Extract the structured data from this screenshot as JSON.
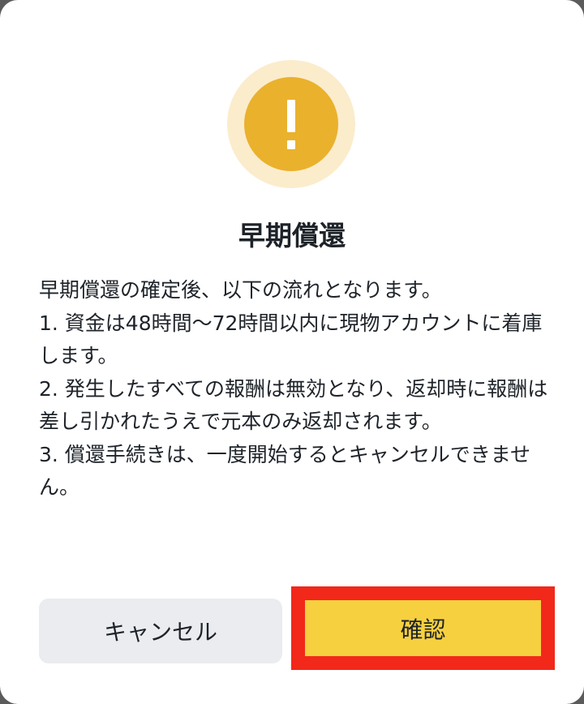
{
  "dialog": {
    "icon": "warning-icon",
    "title": "早期償還",
    "intro": "早期償還の確定後、以下の流れとなります。",
    "items": [
      "1. 資金は48時間〜72時間以内に現物アカウントに着庫します。",
      "2. 発生したすべての報酬は無効となり、返却時に報酬は差し引かれたうえで元本のみ返却されます。",
      "3. 償還手続きは、一度開始するとキャンセルできません。"
    ],
    "cancel_label": "キャンセル",
    "confirm_label": "確認"
  },
  "colors": {
    "warning_ring": "#fbeccc",
    "warning_fill": "#eab12d",
    "confirm_button": "#f6d03f",
    "cancel_button": "#eaecef",
    "highlight_border": "#f2281a",
    "text": "#1e2329"
  }
}
